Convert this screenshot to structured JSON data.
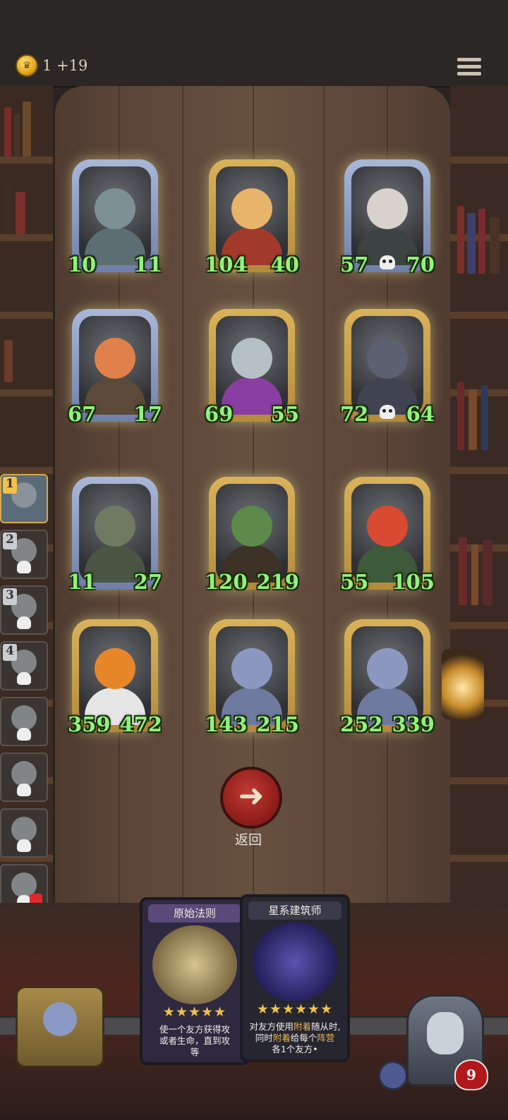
{
  "header": {
    "coin_value": "1 +19"
  },
  "board": {
    "cards": [
      {
        "id": "c1",
        "atk": "10",
        "hp": "11",
        "frame": "silver",
        "face": "#7d9194",
        "body": "#5e6f73",
        "skull": false
      },
      {
        "id": "c2",
        "atk": "104",
        "hp": "40",
        "frame": "gold",
        "face": "#e8b46a",
        "body": "#a23a2c",
        "skull": false
      },
      {
        "id": "c3",
        "atk": "57",
        "hp": "70",
        "frame": "silver",
        "face": "#d7d2cc",
        "body": "#3d4242",
        "skull": true
      },
      {
        "id": "c4",
        "atk": "67",
        "hp": "17",
        "frame": "silver",
        "face": "#e0804a",
        "body": "#5b4a3a",
        "skull": false
      },
      {
        "id": "c5",
        "atk": "69",
        "hp": "55",
        "frame": "gold",
        "face": "#b4c0c4",
        "body": "#8a3ea2",
        "skull": false
      },
      {
        "id": "c6",
        "atk": "72",
        "hp": "64",
        "frame": "gold",
        "face": "#5b6170",
        "body": "#3f4450",
        "skull": true
      },
      {
        "id": "c7",
        "atk": "11",
        "hp": "27",
        "frame": "silver",
        "face": "#6f7a62",
        "body": "#4b5544",
        "skull": false
      },
      {
        "id": "c8",
        "atk": "120",
        "hp": "219",
        "frame": "gold",
        "face": "#5b8a4a",
        "body": "#3c3226",
        "skull": false
      },
      {
        "id": "c9",
        "atk": "55",
        "hp": "105",
        "frame": "gold",
        "face": "#d94a32",
        "body": "#3d5a3a",
        "skull": false
      },
      {
        "id": "c10",
        "atk": "359",
        "hp": "472",
        "frame": "gold",
        "face": "#e8872a",
        "body": "#e6e6e6",
        "skull": false
      },
      {
        "id": "c11",
        "atk": "143",
        "hp": "215",
        "frame": "gold",
        "face": "#8c98c0",
        "body": "#6f7aa0",
        "skull": false
      },
      {
        "id": "c12",
        "atk": "252",
        "hp": "339",
        "frame": "gold",
        "face": "#8c98c0",
        "body": "#6f7aa0",
        "skull": false
      }
    ]
  },
  "sidebar": {
    "slots": [
      {
        "badge": "1",
        "active": true
      },
      {
        "badge": "2",
        "active": false
      },
      {
        "badge": "3",
        "active": false
      },
      {
        "badge": "4",
        "active": false
      },
      {
        "badge": "",
        "active": false
      },
      {
        "badge": "",
        "active": false
      },
      {
        "badge": "",
        "active": false
      },
      {
        "badge": "",
        "active": false
      }
    ]
  },
  "back_button": {
    "label": "返回"
  },
  "hand": {
    "cards": [
      {
        "title": "原始法则",
        "stars": "★★★★★",
        "desc_lines": [
          "使一个友方获得攻",
          "或者生命，直到攻",
          "等"
        ],
        "title_color": "#5a4a7a",
        "art": "#c9b98a"
      },
      {
        "title": "星系建筑师",
        "stars": "★★★★★★",
        "desc_parts": [
          "对友方使用",
          "附着",
          "随从时,",
          "同时",
          "附着",
          "给每个",
          "阵营",
          "各1个友方•"
        ],
        "title_color": "#3a3a48",
        "art": "#3b3580"
      }
    ]
  },
  "player": {
    "health": "9"
  },
  "colors": {
    "stat_text": "#8ff37a",
    "highlight": "#e8b54a",
    "accent_gold": "#d9b25a"
  },
  "icons": {
    "coin": "crown-coin-icon",
    "menu": "hamburger-menu-icon",
    "back": "arrow-left-icon",
    "health": "heart-icon",
    "shield": "shield-icon",
    "skull": "skull-icon"
  }
}
